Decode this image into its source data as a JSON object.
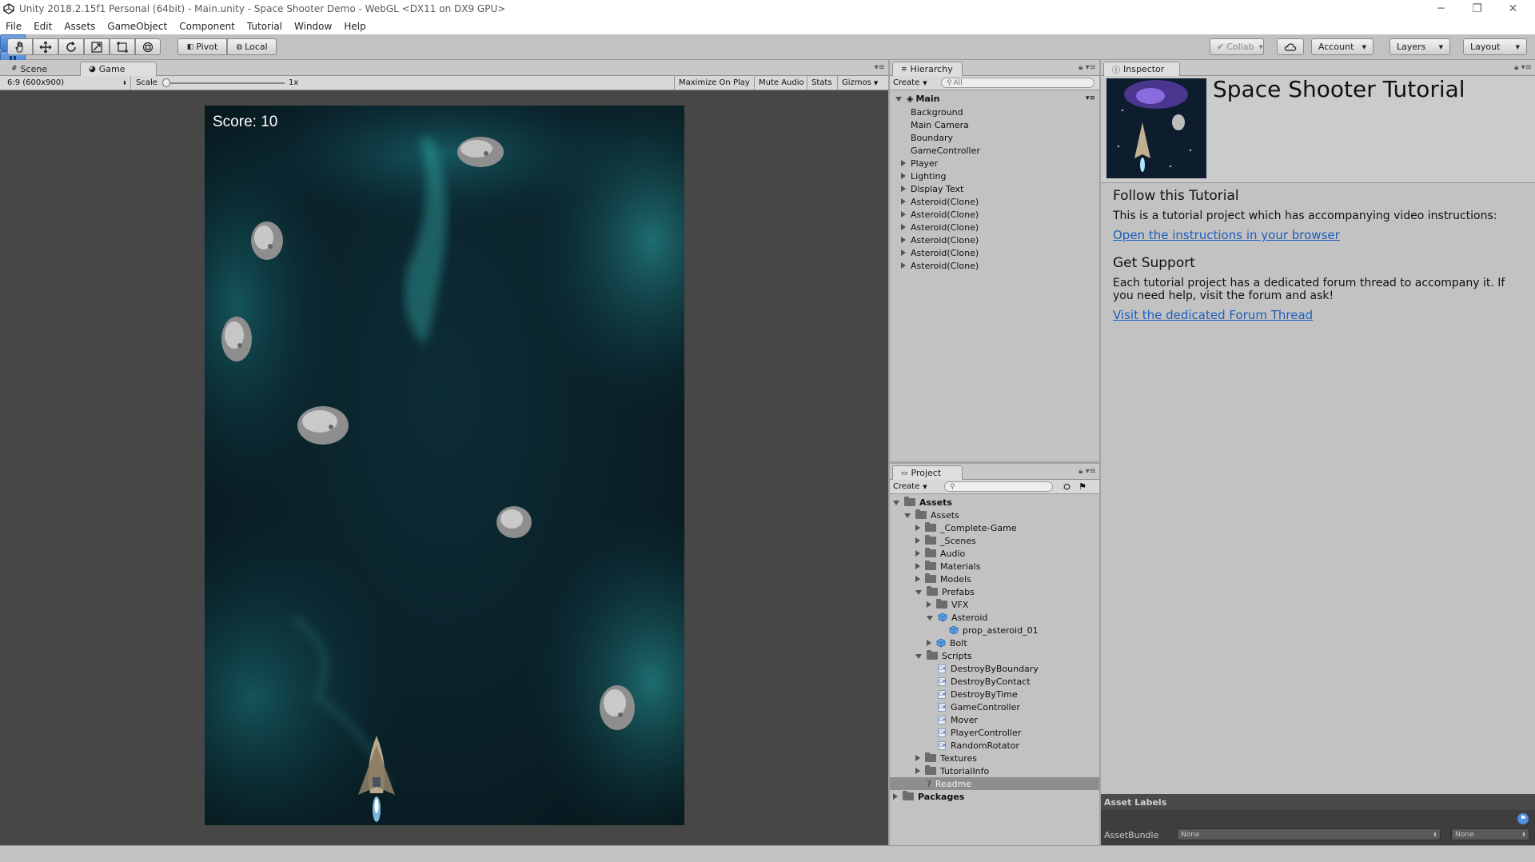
{
  "window": {
    "title": "Unity 2018.2.15f1 Personal (64bit) - Main.unity - Space Shooter Demo - WebGL <DX11 on DX9 GPU>",
    "minimize": "─",
    "restore": "❐",
    "close": "✕"
  },
  "menu": [
    "File",
    "Edit",
    "Assets",
    "GameObject",
    "Component",
    "Tutorial",
    "Window",
    "Help"
  ],
  "toolbar": {
    "pivot": "Pivot",
    "local": "Local",
    "collab": "Collab",
    "account": "Account",
    "layers": "Layers",
    "layout": "Layout"
  },
  "scene_tabs": {
    "scene": "Scene",
    "game": "Game"
  },
  "game_bar": {
    "aspect": "6:9 (600x900)",
    "scale_label": "Scale",
    "scale_value": "1x",
    "maximize": "Maximize On Play",
    "mute": "Mute Audio",
    "stats": "Stats",
    "gizmos": "Gizmos"
  },
  "game": {
    "score": "Score: 10"
  },
  "hierarchy": {
    "tab": "Hierarchy",
    "create": "Create",
    "search_placeholder": "All",
    "scene": "Main",
    "items": [
      {
        "label": "Background",
        "expandable": false
      },
      {
        "label": "Main Camera",
        "expandable": false
      },
      {
        "label": "Boundary",
        "expandable": false
      },
      {
        "label": "GameController",
        "expandable": false
      },
      {
        "label": "Player",
        "expandable": true
      },
      {
        "label": "Lighting",
        "expandable": true
      },
      {
        "label": "Display Text",
        "expandable": true
      },
      {
        "label": "Asteroid(Clone)",
        "expandable": true
      },
      {
        "label": "Asteroid(Clone)",
        "expandable": true
      },
      {
        "label": "Asteroid(Clone)",
        "expandable": true
      },
      {
        "label": "Asteroid(Clone)",
        "expandable": true
      },
      {
        "label": "Asteroid(Clone)",
        "expandable": true
      },
      {
        "label": "Asteroid(Clone)",
        "expandable": true
      }
    ]
  },
  "project": {
    "tab": "Project",
    "create": "Create",
    "tree": [
      {
        "label": "Assets",
        "depth": 0,
        "state": "open",
        "icon": "folder",
        "bold": true
      },
      {
        "label": "Assets",
        "depth": 1,
        "state": "open",
        "icon": "folder"
      },
      {
        "label": "_Complete-Game",
        "depth": 2,
        "state": "closed",
        "icon": "folder"
      },
      {
        "label": "_Scenes",
        "depth": 2,
        "state": "closed",
        "icon": "folder"
      },
      {
        "label": "Audio",
        "depth": 2,
        "state": "closed",
        "icon": "folder"
      },
      {
        "label": "Materials",
        "depth": 2,
        "state": "closed",
        "icon": "folder"
      },
      {
        "label": "Models",
        "depth": 2,
        "state": "closed",
        "icon": "folder"
      },
      {
        "label": "Prefabs",
        "depth": 2,
        "state": "open",
        "icon": "folder"
      },
      {
        "label": "VFX",
        "depth": 3,
        "state": "closed",
        "icon": "folder"
      },
      {
        "label": "Asteroid",
        "depth": 3,
        "state": "open",
        "icon": "prefab"
      },
      {
        "label": "prop_asteroid_01",
        "depth": 4,
        "state": "none",
        "icon": "prefab"
      },
      {
        "label": "Bolt",
        "depth": 3,
        "state": "closed",
        "icon": "prefab"
      },
      {
        "label": "Scripts",
        "depth": 2,
        "state": "open",
        "icon": "folder"
      },
      {
        "label": "DestroyByBoundary",
        "depth": 3,
        "state": "none",
        "icon": "script"
      },
      {
        "label": "DestroyByContact",
        "depth": 3,
        "state": "none",
        "icon": "script"
      },
      {
        "label": "DestroyByTime",
        "depth": 3,
        "state": "none",
        "icon": "script"
      },
      {
        "label": "GameController",
        "depth": 3,
        "state": "none",
        "icon": "script"
      },
      {
        "label": "Mover",
        "depth": 3,
        "state": "none",
        "icon": "script"
      },
      {
        "label": "PlayerController",
        "depth": 3,
        "state": "none",
        "icon": "script"
      },
      {
        "label": "RandomRotator",
        "depth": 3,
        "state": "none",
        "icon": "script"
      },
      {
        "label": "Textures",
        "depth": 2,
        "state": "closed",
        "icon": "folder"
      },
      {
        "label": "TutorialInfo",
        "depth": 2,
        "state": "closed",
        "icon": "folder"
      },
      {
        "label": "Readme",
        "depth": 2,
        "state": "none",
        "icon": "readme",
        "selected": true
      },
      {
        "label": "Packages",
        "depth": 0,
        "state": "closed",
        "icon": "folder",
        "bold": true
      }
    ]
  },
  "inspector": {
    "tab": "Inspector",
    "title": "Space Shooter Tutorial",
    "section1_heading": "Follow this Tutorial",
    "section1_body": "This is a tutorial project which has accompanying video instructions:",
    "section1_link": "Open the instructions in your browser",
    "section2_heading": "Get Support",
    "section2_body": "Each tutorial project has a dedicated forum thread to accompany it. If you need help, visit the forum and ask!",
    "section2_link": "Visit the dedicated Forum Thread",
    "asset_labels": "Asset Labels",
    "asset_bundle": "AssetBundle",
    "bundle_value": "None",
    "variant_value": "None"
  }
}
